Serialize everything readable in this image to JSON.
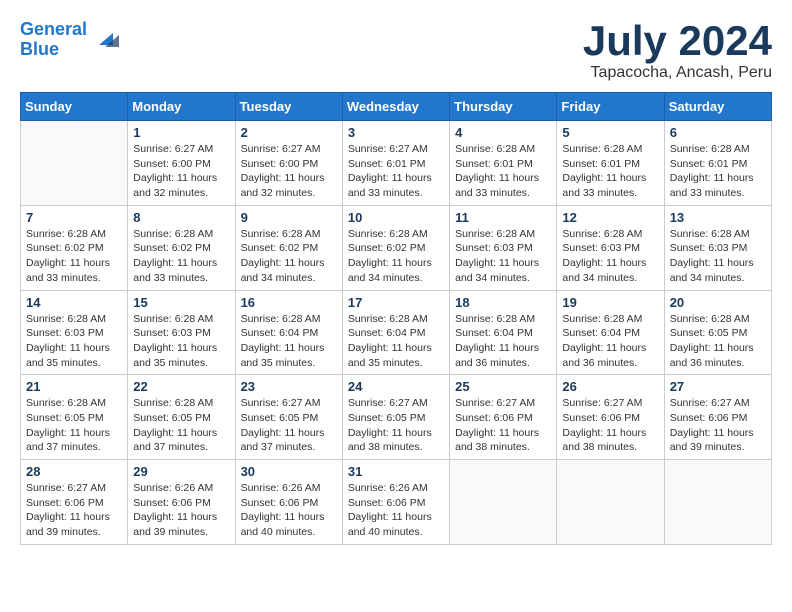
{
  "header": {
    "logo_line1": "General",
    "logo_line2": "Blue",
    "month_year": "July 2024",
    "location": "Tapacocha, Ancash, Peru"
  },
  "days_of_week": [
    "Sunday",
    "Monday",
    "Tuesday",
    "Wednesday",
    "Thursday",
    "Friday",
    "Saturday"
  ],
  "weeks": [
    [
      {
        "day": "",
        "info": ""
      },
      {
        "day": "1",
        "info": "Sunrise: 6:27 AM\nSunset: 6:00 PM\nDaylight: 11 hours\nand 32 minutes."
      },
      {
        "day": "2",
        "info": "Sunrise: 6:27 AM\nSunset: 6:00 PM\nDaylight: 11 hours\nand 32 minutes."
      },
      {
        "day": "3",
        "info": "Sunrise: 6:27 AM\nSunset: 6:01 PM\nDaylight: 11 hours\nand 33 minutes."
      },
      {
        "day": "4",
        "info": "Sunrise: 6:28 AM\nSunset: 6:01 PM\nDaylight: 11 hours\nand 33 minutes."
      },
      {
        "day": "5",
        "info": "Sunrise: 6:28 AM\nSunset: 6:01 PM\nDaylight: 11 hours\nand 33 minutes."
      },
      {
        "day": "6",
        "info": "Sunrise: 6:28 AM\nSunset: 6:01 PM\nDaylight: 11 hours\nand 33 minutes."
      }
    ],
    [
      {
        "day": "7",
        "info": "Sunrise: 6:28 AM\nSunset: 6:02 PM\nDaylight: 11 hours\nand 33 minutes."
      },
      {
        "day": "8",
        "info": "Sunrise: 6:28 AM\nSunset: 6:02 PM\nDaylight: 11 hours\nand 33 minutes."
      },
      {
        "day": "9",
        "info": "Sunrise: 6:28 AM\nSunset: 6:02 PM\nDaylight: 11 hours\nand 34 minutes."
      },
      {
        "day": "10",
        "info": "Sunrise: 6:28 AM\nSunset: 6:02 PM\nDaylight: 11 hours\nand 34 minutes."
      },
      {
        "day": "11",
        "info": "Sunrise: 6:28 AM\nSunset: 6:03 PM\nDaylight: 11 hours\nand 34 minutes."
      },
      {
        "day": "12",
        "info": "Sunrise: 6:28 AM\nSunset: 6:03 PM\nDaylight: 11 hours\nand 34 minutes."
      },
      {
        "day": "13",
        "info": "Sunrise: 6:28 AM\nSunset: 6:03 PM\nDaylight: 11 hours\nand 34 minutes."
      }
    ],
    [
      {
        "day": "14",
        "info": "Sunrise: 6:28 AM\nSunset: 6:03 PM\nDaylight: 11 hours\nand 35 minutes."
      },
      {
        "day": "15",
        "info": "Sunrise: 6:28 AM\nSunset: 6:03 PM\nDaylight: 11 hours\nand 35 minutes."
      },
      {
        "day": "16",
        "info": "Sunrise: 6:28 AM\nSunset: 6:04 PM\nDaylight: 11 hours\nand 35 minutes."
      },
      {
        "day": "17",
        "info": "Sunrise: 6:28 AM\nSunset: 6:04 PM\nDaylight: 11 hours\nand 35 minutes."
      },
      {
        "day": "18",
        "info": "Sunrise: 6:28 AM\nSunset: 6:04 PM\nDaylight: 11 hours\nand 36 minutes."
      },
      {
        "day": "19",
        "info": "Sunrise: 6:28 AM\nSunset: 6:04 PM\nDaylight: 11 hours\nand 36 minutes."
      },
      {
        "day": "20",
        "info": "Sunrise: 6:28 AM\nSunset: 6:05 PM\nDaylight: 11 hours\nand 36 minutes."
      }
    ],
    [
      {
        "day": "21",
        "info": "Sunrise: 6:28 AM\nSunset: 6:05 PM\nDaylight: 11 hours\nand 37 minutes."
      },
      {
        "day": "22",
        "info": "Sunrise: 6:28 AM\nSunset: 6:05 PM\nDaylight: 11 hours\nand 37 minutes."
      },
      {
        "day": "23",
        "info": "Sunrise: 6:27 AM\nSunset: 6:05 PM\nDaylight: 11 hours\nand 37 minutes."
      },
      {
        "day": "24",
        "info": "Sunrise: 6:27 AM\nSunset: 6:05 PM\nDaylight: 11 hours\nand 38 minutes."
      },
      {
        "day": "25",
        "info": "Sunrise: 6:27 AM\nSunset: 6:06 PM\nDaylight: 11 hours\nand 38 minutes."
      },
      {
        "day": "26",
        "info": "Sunrise: 6:27 AM\nSunset: 6:06 PM\nDaylight: 11 hours\nand 38 minutes."
      },
      {
        "day": "27",
        "info": "Sunrise: 6:27 AM\nSunset: 6:06 PM\nDaylight: 11 hours\nand 39 minutes."
      }
    ],
    [
      {
        "day": "28",
        "info": "Sunrise: 6:27 AM\nSunset: 6:06 PM\nDaylight: 11 hours\nand 39 minutes."
      },
      {
        "day": "29",
        "info": "Sunrise: 6:26 AM\nSunset: 6:06 PM\nDaylight: 11 hours\nand 39 minutes."
      },
      {
        "day": "30",
        "info": "Sunrise: 6:26 AM\nSunset: 6:06 PM\nDaylight: 11 hours\nand 40 minutes."
      },
      {
        "day": "31",
        "info": "Sunrise: 6:26 AM\nSunset: 6:06 PM\nDaylight: 11 hours\nand 40 minutes."
      },
      {
        "day": "",
        "info": ""
      },
      {
        "day": "",
        "info": ""
      },
      {
        "day": "",
        "info": ""
      }
    ]
  ]
}
